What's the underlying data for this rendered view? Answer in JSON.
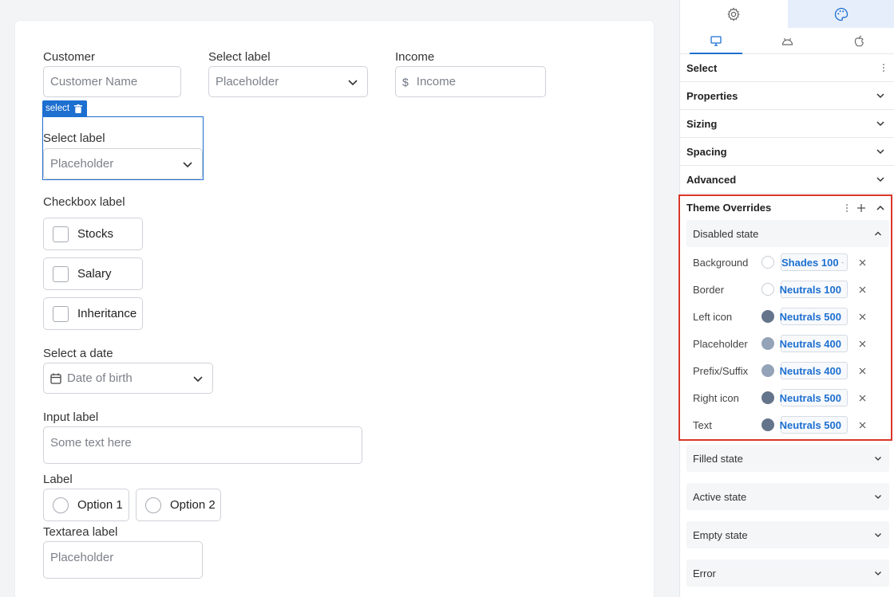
{
  "form": {
    "customer": {
      "label": "Customer",
      "placeholder": "Customer Name"
    },
    "select1": {
      "label": "Select label",
      "placeholder": "Placeholder"
    },
    "income": {
      "label": "Income",
      "prefix": "$",
      "placeholder": "Income"
    },
    "selected_tag": "select",
    "select2": {
      "label": "Select label",
      "placeholder": "Placeholder"
    },
    "checkbox": {
      "label": "Checkbox label",
      "options": [
        "Stocks",
        "Salary",
        "Inheritance"
      ]
    },
    "date": {
      "label": "Select a date",
      "placeholder": "Date of birth"
    },
    "input": {
      "label": "Input label",
      "placeholder": "Some text here"
    },
    "radio": {
      "label": "Label",
      "options": [
        "Option 1",
        "Option 2"
      ]
    },
    "textarea": {
      "label": "Textarea label",
      "placeholder": "Placeholder"
    }
  },
  "panel": {
    "top_tabs": [
      "settings-icon",
      "palette-icon"
    ],
    "device_tabs": [
      "desktop-icon",
      "android-icon",
      "apple-icon"
    ],
    "component": "Select",
    "sections": [
      "Properties",
      "Sizing",
      "Spacing",
      "Advanced"
    ],
    "theme_overrides": {
      "title": "Theme Overrides",
      "disabled_state": "Disabled state",
      "rows": [
        {
          "name": "Background",
          "token": "Shades 100",
          "color": "#ffffff"
        },
        {
          "name": "Border",
          "token": "Neutrals 100",
          "color": "#ffffff"
        },
        {
          "name": "Left icon",
          "token": "Neutrals 500",
          "color": "#64748b"
        },
        {
          "name": "Placeholder",
          "token": "Neutrals 400",
          "color": "#94a3b8"
        },
        {
          "name": "Prefix/Suffix",
          "token": "Neutrals 400",
          "color": "#94a3b8"
        },
        {
          "name": "Right icon",
          "token": "Neutrals 500",
          "color": "#64748b"
        },
        {
          "name": "Text",
          "token": "Neutrals 500",
          "color": "#64748b"
        }
      ]
    },
    "states": [
      "Filled state",
      "Active state",
      "Empty state",
      "Error"
    ],
    "colors": {
      "accent": "#1d6fd0",
      "highlight": "#d9372a"
    }
  }
}
